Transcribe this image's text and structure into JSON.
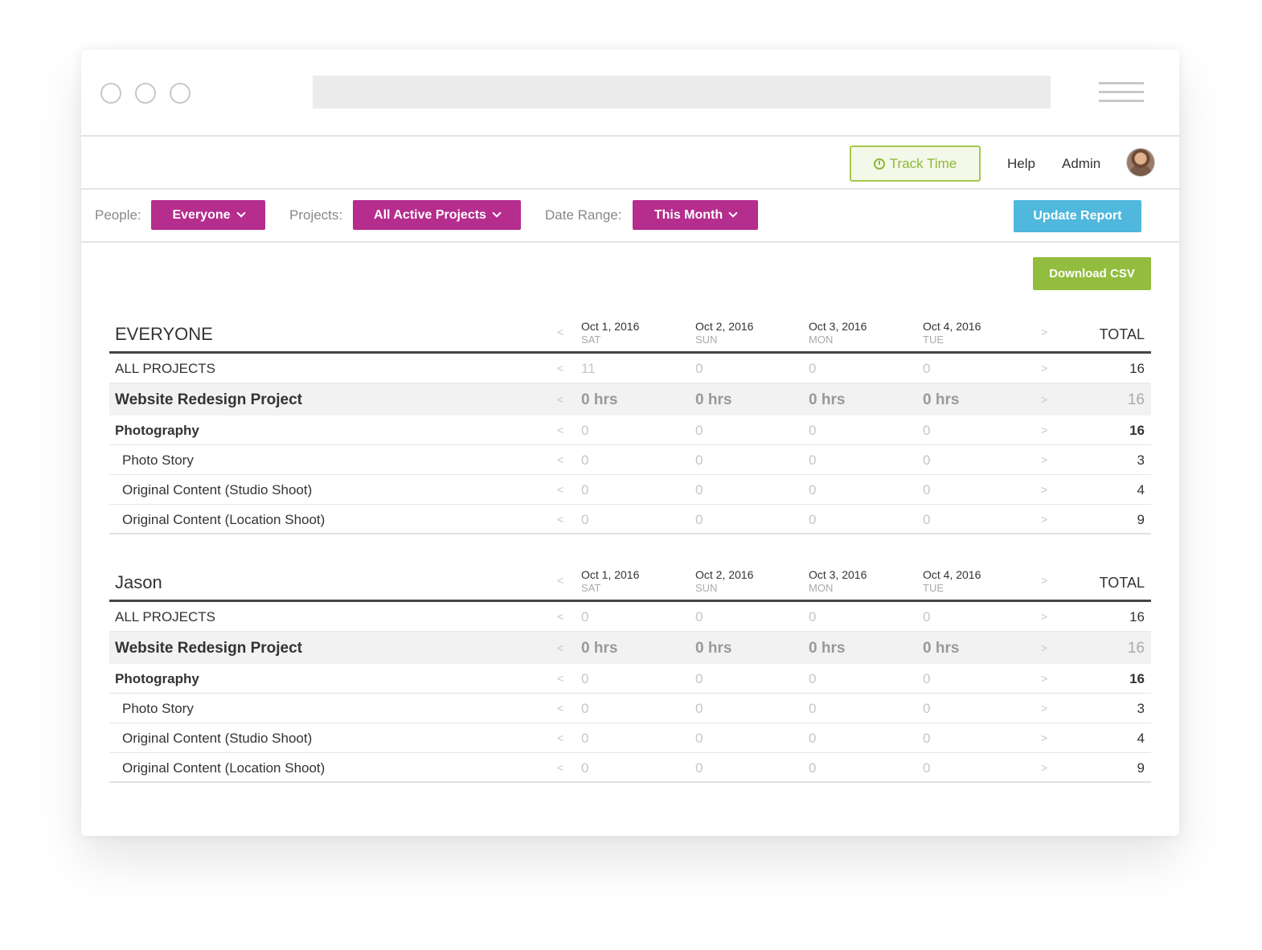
{
  "nav": {
    "track_time": "Track Time",
    "help": "Help",
    "admin": "Admin"
  },
  "filters": {
    "people_label": "People:",
    "people_value": "Everyone",
    "projects_label": "Projects:",
    "projects_value": "All Active Projects",
    "date_label": "Date Range:",
    "date_value": "This Month",
    "update_button": "Update Report"
  },
  "download_csv": "Download CSV",
  "colors": {
    "magenta": "#b52d8d",
    "blue": "#4fb8dc",
    "green": "#92bd3e"
  },
  "reports": [
    {
      "title": "EVERYONE",
      "dates": [
        {
          "date": "Oct 1, 2016",
          "dow": "SAT"
        },
        {
          "date": "Oct 2, 2016",
          "dow": "SUN"
        },
        {
          "date": "Oct 3, 2016",
          "dow": "MON"
        },
        {
          "date": "Oct 4, 2016",
          "dow": "TUE"
        }
      ],
      "total_label": "TOTAL",
      "rows": [
        {
          "label": "ALL PROJECTS",
          "values": [
            "11",
            "0",
            "0",
            "0"
          ],
          "total": "16"
        },
        {
          "label": "Website Redesign Project",
          "values": [
            "0 hrs",
            "0 hrs",
            "0 hrs",
            "0 hrs"
          ],
          "total": "16"
        },
        {
          "label": "Photography",
          "values": [
            "0",
            "0",
            "0",
            "0"
          ],
          "total": "16"
        },
        {
          "label": "Photo Story",
          "values": [
            "0",
            "0",
            "0",
            "0"
          ],
          "total": "3"
        },
        {
          "label": "Original Content (Studio Shoot)",
          "values": [
            "0",
            "0",
            "0",
            "0"
          ],
          "total": "4"
        },
        {
          "label": "Original Content (Location Shoot)",
          "values": [
            "0",
            "0",
            "0",
            "0"
          ],
          "total": "9"
        }
      ]
    },
    {
      "title": "Jason",
      "dates": [
        {
          "date": "Oct 1, 2016",
          "dow": "SAT"
        },
        {
          "date": "Oct 2, 2016",
          "dow": "SUN"
        },
        {
          "date": "Oct 3, 2016",
          "dow": "MON"
        },
        {
          "date": "Oct 4, 2016",
          "dow": "TUE"
        }
      ],
      "total_label": "TOTAL",
      "rows": [
        {
          "label": "ALL PROJECTS",
          "values": [
            "0",
            "0",
            "0",
            "0"
          ],
          "total": "16"
        },
        {
          "label": "Website Redesign Project",
          "values": [
            "0 hrs",
            "0 hrs",
            "0 hrs",
            "0 hrs"
          ],
          "total": "16"
        },
        {
          "label": "Photography",
          "values": [
            "0",
            "0",
            "0",
            "0"
          ],
          "total": "16"
        },
        {
          "label": "Photo Story",
          "values": [
            "0",
            "0",
            "0",
            "0"
          ],
          "total": "3"
        },
        {
          "label": "Original Content (Studio Shoot)",
          "values": [
            "0",
            "0",
            "0",
            "0"
          ],
          "total": "4"
        },
        {
          "label": "Original Content (Location Shoot)",
          "values": [
            "0",
            "0",
            "0",
            "0"
          ],
          "total": "9"
        }
      ]
    }
  ]
}
